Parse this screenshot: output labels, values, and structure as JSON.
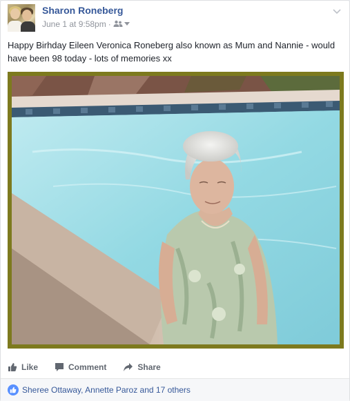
{
  "post": {
    "author": "Sharon Roneberg",
    "timestamp": "June 1 at 9:58pm",
    "separator": "·",
    "text": "Happy Birhday Eileen Veronica Roneberg also known as Mum and Nannie - would have been 98 today - lots of memories xx"
  },
  "actions": {
    "like_label": "Like",
    "comment_label": "Comment",
    "share_label": "Share"
  },
  "reactions": {
    "summary": "Sheree Ottaway, Annette Paroz and 17 others"
  },
  "colors": {
    "link": "#365899",
    "frame": "#7d7a1e",
    "like_badge": "#5890ff",
    "action_text": "#616770",
    "meta_text": "#90949c"
  },
  "icons": {
    "audience": "friends-audience-icon",
    "chevron": "chevron-down-icon",
    "like": "thumbs-up-icon",
    "comment": "comment-bubble-icon",
    "share": "share-arrow-icon",
    "reaction": "like-reaction-icon"
  }
}
